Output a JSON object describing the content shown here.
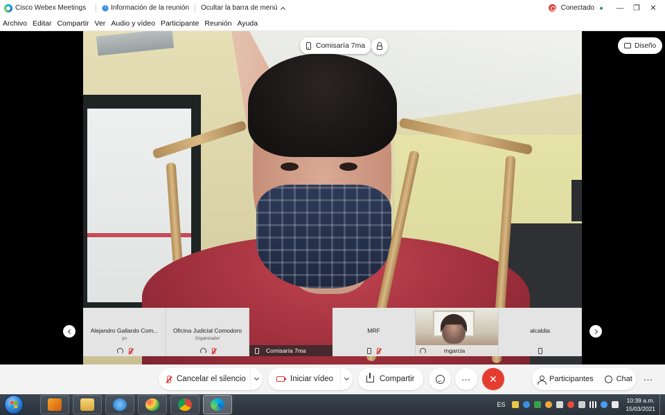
{
  "titlebar": {
    "app_title": "Cisco Webex Meetings",
    "meeting_info": "Información de la reunión",
    "hide_menu": "Ocultar la barra de menú",
    "status": "Conectado",
    "status_color": "#2e9c3f",
    "controls": [
      "minimize-icon",
      "restore-icon",
      "close-icon"
    ]
  },
  "menu": {
    "items": [
      "Archivo",
      "Editar",
      "Compartir",
      "Ver",
      "Audio y vídeo",
      "Participante",
      "Reunión",
      "Ayuda"
    ]
  },
  "stage": {
    "active_speaker": "Comisaría 7ma",
    "layout_label": "Diseño"
  },
  "filmstrip": {
    "participants": [
      {
        "name": "Alejandro Gallardo Com...",
        "role": "yo",
        "icons": [
          "audio-icon",
          "mic-muted-icon"
        ]
      },
      {
        "name": "Oficina Judicial Comodoro",
        "role": "Organizador",
        "icons": [
          "audio-icon",
          "mic-muted-icon"
        ]
      },
      {
        "name": "Comisaría 7ma",
        "role": "",
        "icons": [
          "phone-icon"
        ]
      },
      {
        "name": "MRF",
        "role": "",
        "icons": [
          "phone-icon",
          "mic-muted-icon"
        ]
      },
      {
        "name": "mgarcia",
        "role": "",
        "icons": [
          "audio-icon"
        ]
      },
      {
        "name": "alcaldia",
        "role": "",
        "icons": [
          "phone-icon"
        ]
      }
    ]
  },
  "controls": {
    "mute_label": "Cancelar el silencio",
    "video_label": "Iniciar vídeo",
    "share_label": "Compartir",
    "participants_label": "Participantes",
    "chat_label": "Chat",
    "end_color": "#e43d30"
  },
  "taskbar": {
    "language": "ES",
    "time": "10:39 a.m.",
    "date": "15/03/2021"
  }
}
